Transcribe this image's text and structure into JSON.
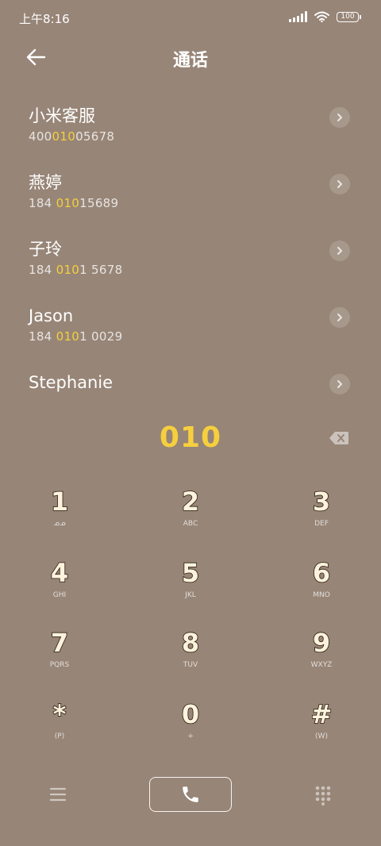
{
  "status_bar": {
    "time": "上午8:16",
    "battery": "100"
  },
  "header": {
    "title": "通话"
  },
  "contacts": [
    {
      "name": "小米客服",
      "number_pre": "400",
      "number_match": "010",
      "number_post": "05678"
    },
    {
      "name": "燕婷",
      "number_pre": "184 ",
      "number_match": "010",
      "number_post": "15689"
    },
    {
      "name": "子玲",
      "number_pre": "184 ",
      "number_match": "010",
      "number_post": "1 5678"
    },
    {
      "name": "Jason",
      "number_pre": "184 ",
      "number_match": "010",
      "number_post": "1 0029"
    },
    {
      "name": "Stephanie",
      "number_pre": "",
      "number_match": "",
      "number_post": ""
    }
  ],
  "dialed_number": "010",
  "keypad": [
    {
      "digit": "1",
      "letters": "ᓄᓄ"
    },
    {
      "digit": "2",
      "letters": "ABC"
    },
    {
      "digit": "3",
      "letters": "DEF"
    },
    {
      "digit": "4",
      "letters": "GHI"
    },
    {
      "digit": "5",
      "letters": "JKL"
    },
    {
      "digit": "6",
      "letters": "MNO"
    },
    {
      "digit": "7",
      "letters": "PQRS"
    },
    {
      "digit": "8",
      "letters": "TUV"
    },
    {
      "digit": "9",
      "letters": "WXYZ"
    },
    {
      "digit": "*",
      "letters": "(P)"
    },
    {
      "digit": "0",
      "letters": "+"
    },
    {
      "digit": "#",
      "letters": "(W)"
    }
  ],
  "colors": {
    "background": "#978577",
    "highlight": "#f6cf3e"
  }
}
